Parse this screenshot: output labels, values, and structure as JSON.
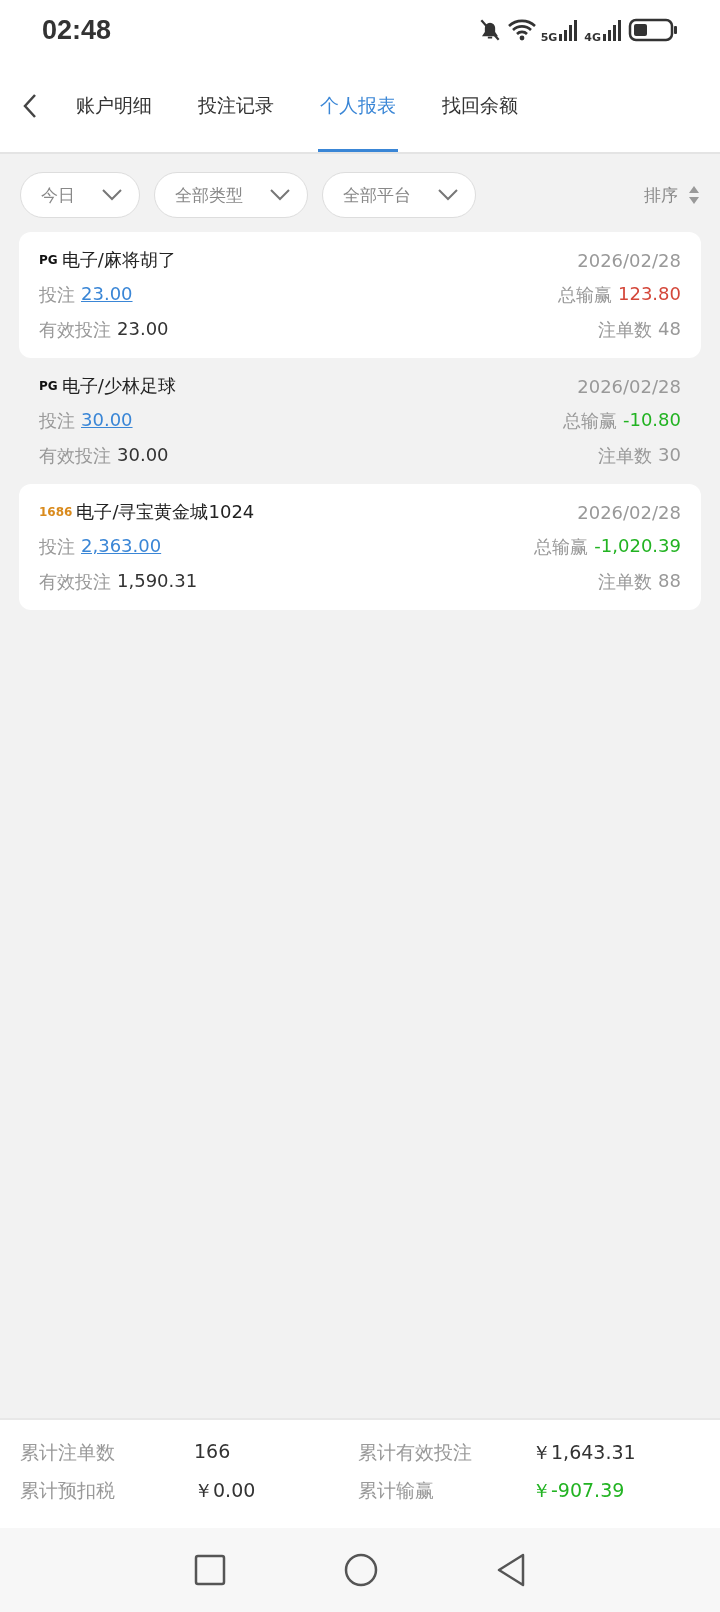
{
  "status_bar": {
    "time": "02:48",
    "network_1": "5G",
    "network_2": "4G"
  },
  "tabs": [
    {
      "label": "账户明细",
      "selected": false
    },
    {
      "label": "投注记录",
      "selected": false
    },
    {
      "label": "个人报表",
      "selected": true
    },
    {
      "label": "找回余额",
      "selected": false
    }
  ],
  "filters": [
    {
      "label": "今日"
    },
    {
      "label": "全部类型"
    },
    {
      "label": "全部平台"
    }
  ],
  "sort": {
    "label": "排序"
  },
  "records": [
    {
      "logo": "PG",
      "color": "#111111",
      "title": "电子/麻将胡了",
      "date": "2026/02/28",
      "bet_label": "投注",
      "bet": "23.00",
      "winloss_label": "总输赢",
      "winloss": "123.80",
      "loss": false,
      "valid_label": "有效投注",
      "valid": "23.00",
      "count_label": "注单数",
      "count": "48",
      "highlighted": true
    },
    {
      "logo": "PG",
      "color": "#111111",
      "title": "电子/少林足球",
      "date": "2026/02/28",
      "bet_label": "投注",
      "bet": "30.00",
      "winloss_label": "总输赢",
      "winloss": "-10.80",
      "loss": true,
      "valid_label": "有效投注",
      "valid": "30.00",
      "count_label": "注单数",
      "count": "30",
      "highlighted": false
    },
    {
      "logo": "1686",
      "color": "#d98a1c",
      "title": "电子/寻宝黄金城1024",
      "date": "2026/02/28",
      "bet_label": "投注",
      "bet": "2,363.00",
      "winloss_label": "总输赢",
      "winloss": "-1,020.39",
      "loss": true,
      "valid_label": "有效投注",
      "valid": "1,590.31",
      "count_label": "注单数",
      "count": "88",
      "highlighted": true
    }
  ],
  "summary": [
    {
      "label": "累计注单数",
      "value": "166",
      "loss": false
    },
    {
      "label": "累计有效投注",
      "value": "￥1,643.31",
      "loss": false
    },
    {
      "label": "累计预扣税",
      "value": "￥0.00",
      "loss": false
    },
    {
      "label": "累计输赢",
      "value": "￥-907.39",
      "loss": true
    }
  ]
}
